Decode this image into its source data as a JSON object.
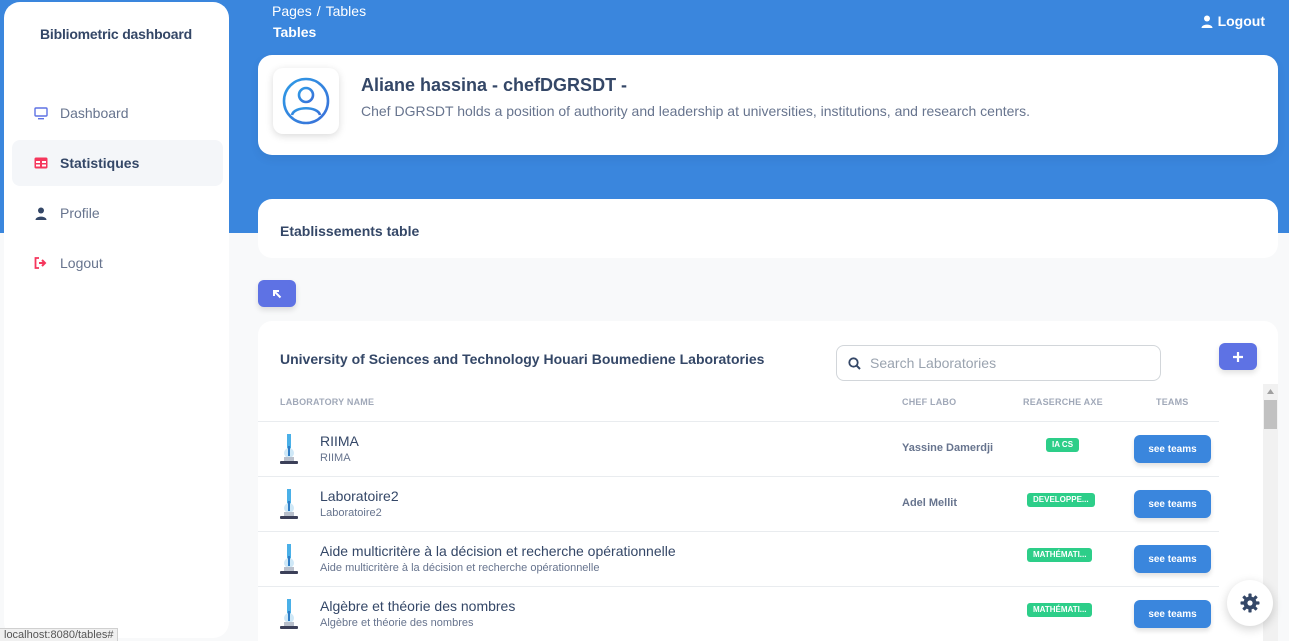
{
  "sidebar": {
    "brand": "Bibliometric dashboard",
    "items": [
      {
        "label": "Dashboard",
        "icon": "monitor-icon"
      },
      {
        "label": "Statistiques",
        "icon": "table-icon"
      },
      {
        "label": "Profile",
        "icon": "user-icon"
      },
      {
        "label": "Logout",
        "icon": "logout-icon"
      }
    ]
  },
  "header": {
    "breadcrumb_root": "Pages",
    "breadcrumb_sep": "/",
    "breadcrumb_current": "Tables",
    "title": "Tables",
    "logout": "Logout"
  },
  "profile": {
    "name": "Aliane hassina - chefDGRSDT -",
    "description": "Chef DGRSDT holds a position of authority and leadership at universities, institutions, and research centers."
  },
  "etablissements": {
    "title": "Etablissements table"
  },
  "labs": {
    "title": "University of Sciences and Technology Houari Boumediene Laboratories",
    "search_placeholder": "Search Laboratories",
    "columns": [
      "LABORATORY NAME",
      "CHEF LABO",
      "REASERCHE AXE",
      "TEAMS"
    ],
    "rows": [
      {
        "name": "RIIMA",
        "sub": "RIIMA",
        "chef": "Yassine Damerdji",
        "axe": "IA CS",
        "button": "see teams"
      },
      {
        "name": "Laboratoire2",
        "sub": "Laboratoire2",
        "chef": "Adel Mellit",
        "axe": "DEVELOPPE...",
        "button": "see teams"
      },
      {
        "name": "Aide multicritère à la décision et recherche opérationnelle",
        "sub": "Aide multicritère à la décision et recherche opérationnelle",
        "chef": "",
        "axe": "MATHÉMATI...",
        "button": "see teams"
      },
      {
        "name": "Algèbre et théorie des nombres",
        "sub": "Algèbre et théorie des nombres",
        "chef": "",
        "axe": "MATHÉMATI...",
        "button": "see teams"
      }
    ]
  },
  "status_url": "localhost:8080/tables#",
  "colors": {
    "primary_blue": "#3a86dd",
    "indigo": "#5e72e4",
    "success_green": "#2dce89",
    "text_dark": "#344767"
  }
}
